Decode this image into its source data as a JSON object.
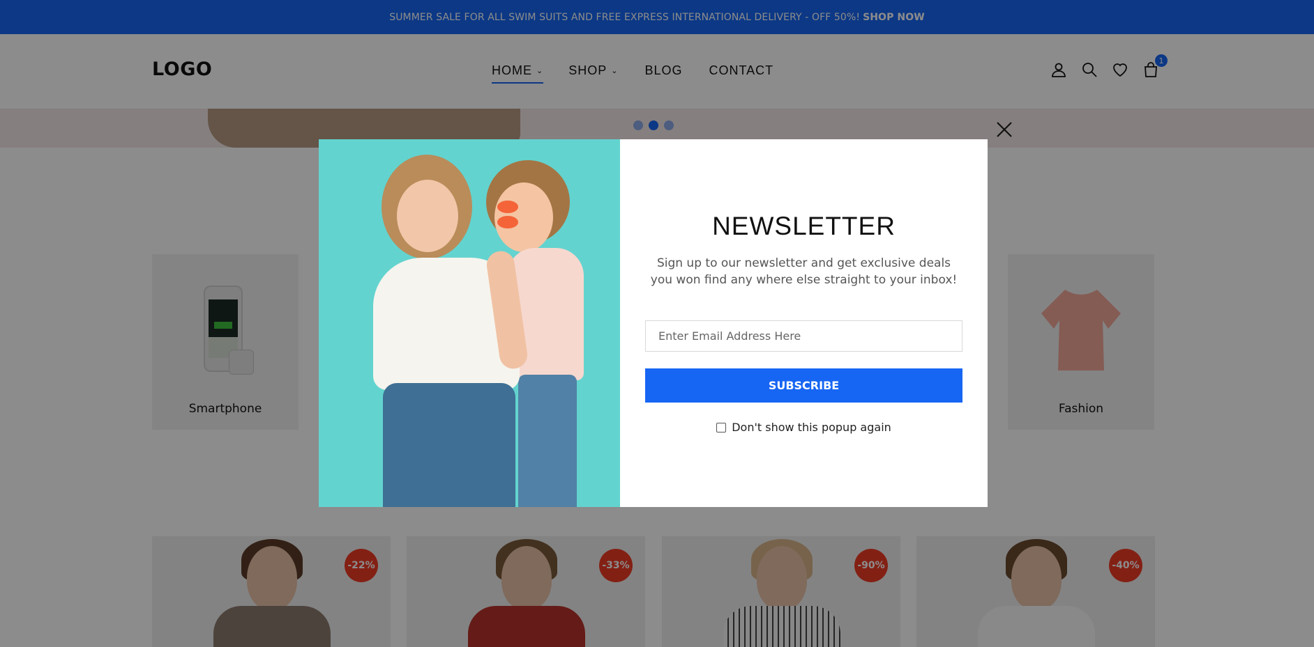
{
  "topbar": {
    "message": "SUMMER SALE FOR ALL SWIM SUITS AND FREE EXPRESS INTERNATIONAL DELIVERY - OFF 50%!",
    "cta": "SHOP NOW"
  },
  "header": {
    "logo": "LOGO",
    "nav": [
      {
        "label": "HOME",
        "has_dropdown": true,
        "active": true
      },
      {
        "label": "SHOP",
        "has_dropdown": true,
        "active": false
      },
      {
        "label": "BLOG",
        "has_dropdown": false,
        "active": false
      },
      {
        "label": "CONTACT",
        "has_dropdown": false,
        "active": false
      }
    ],
    "icons": [
      "user-icon",
      "search-icon",
      "heart-icon",
      "cart-icon"
    ],
    "cart_count": "1"
  },
  "hero": {
    "slider_dots": 3,
    "active_dot": 2
  },
  "categories": [
    {
      "label": "Smartphone"
    },
    {
      "label": "Fashion"
    }
  ],
  "products": [
    {
      "discount": "-22%"
    },
    {
      "discount": "-33%"
    },
    {
      "discount": "-90%"
    },
    {
      "discount": "-40%"
    }
  ],
  "newsletter": {
    "title": "NEWSLETTER",
    "description": "Sign up to our newsletter and get exclusive deals you won find any where else straight to your inbox!",
    "email_placeholder": "Enter Email Address Here",
    "subscribe_label": "SUBSCRIBE",
    "optout_label": "Don't show this popup again"
  },
  "colors": {
    "accent": "#1766f3",
    "badge": "#ee3b25",
    "overlay": "rgba(0,0,0,0.45)"
  }
}
